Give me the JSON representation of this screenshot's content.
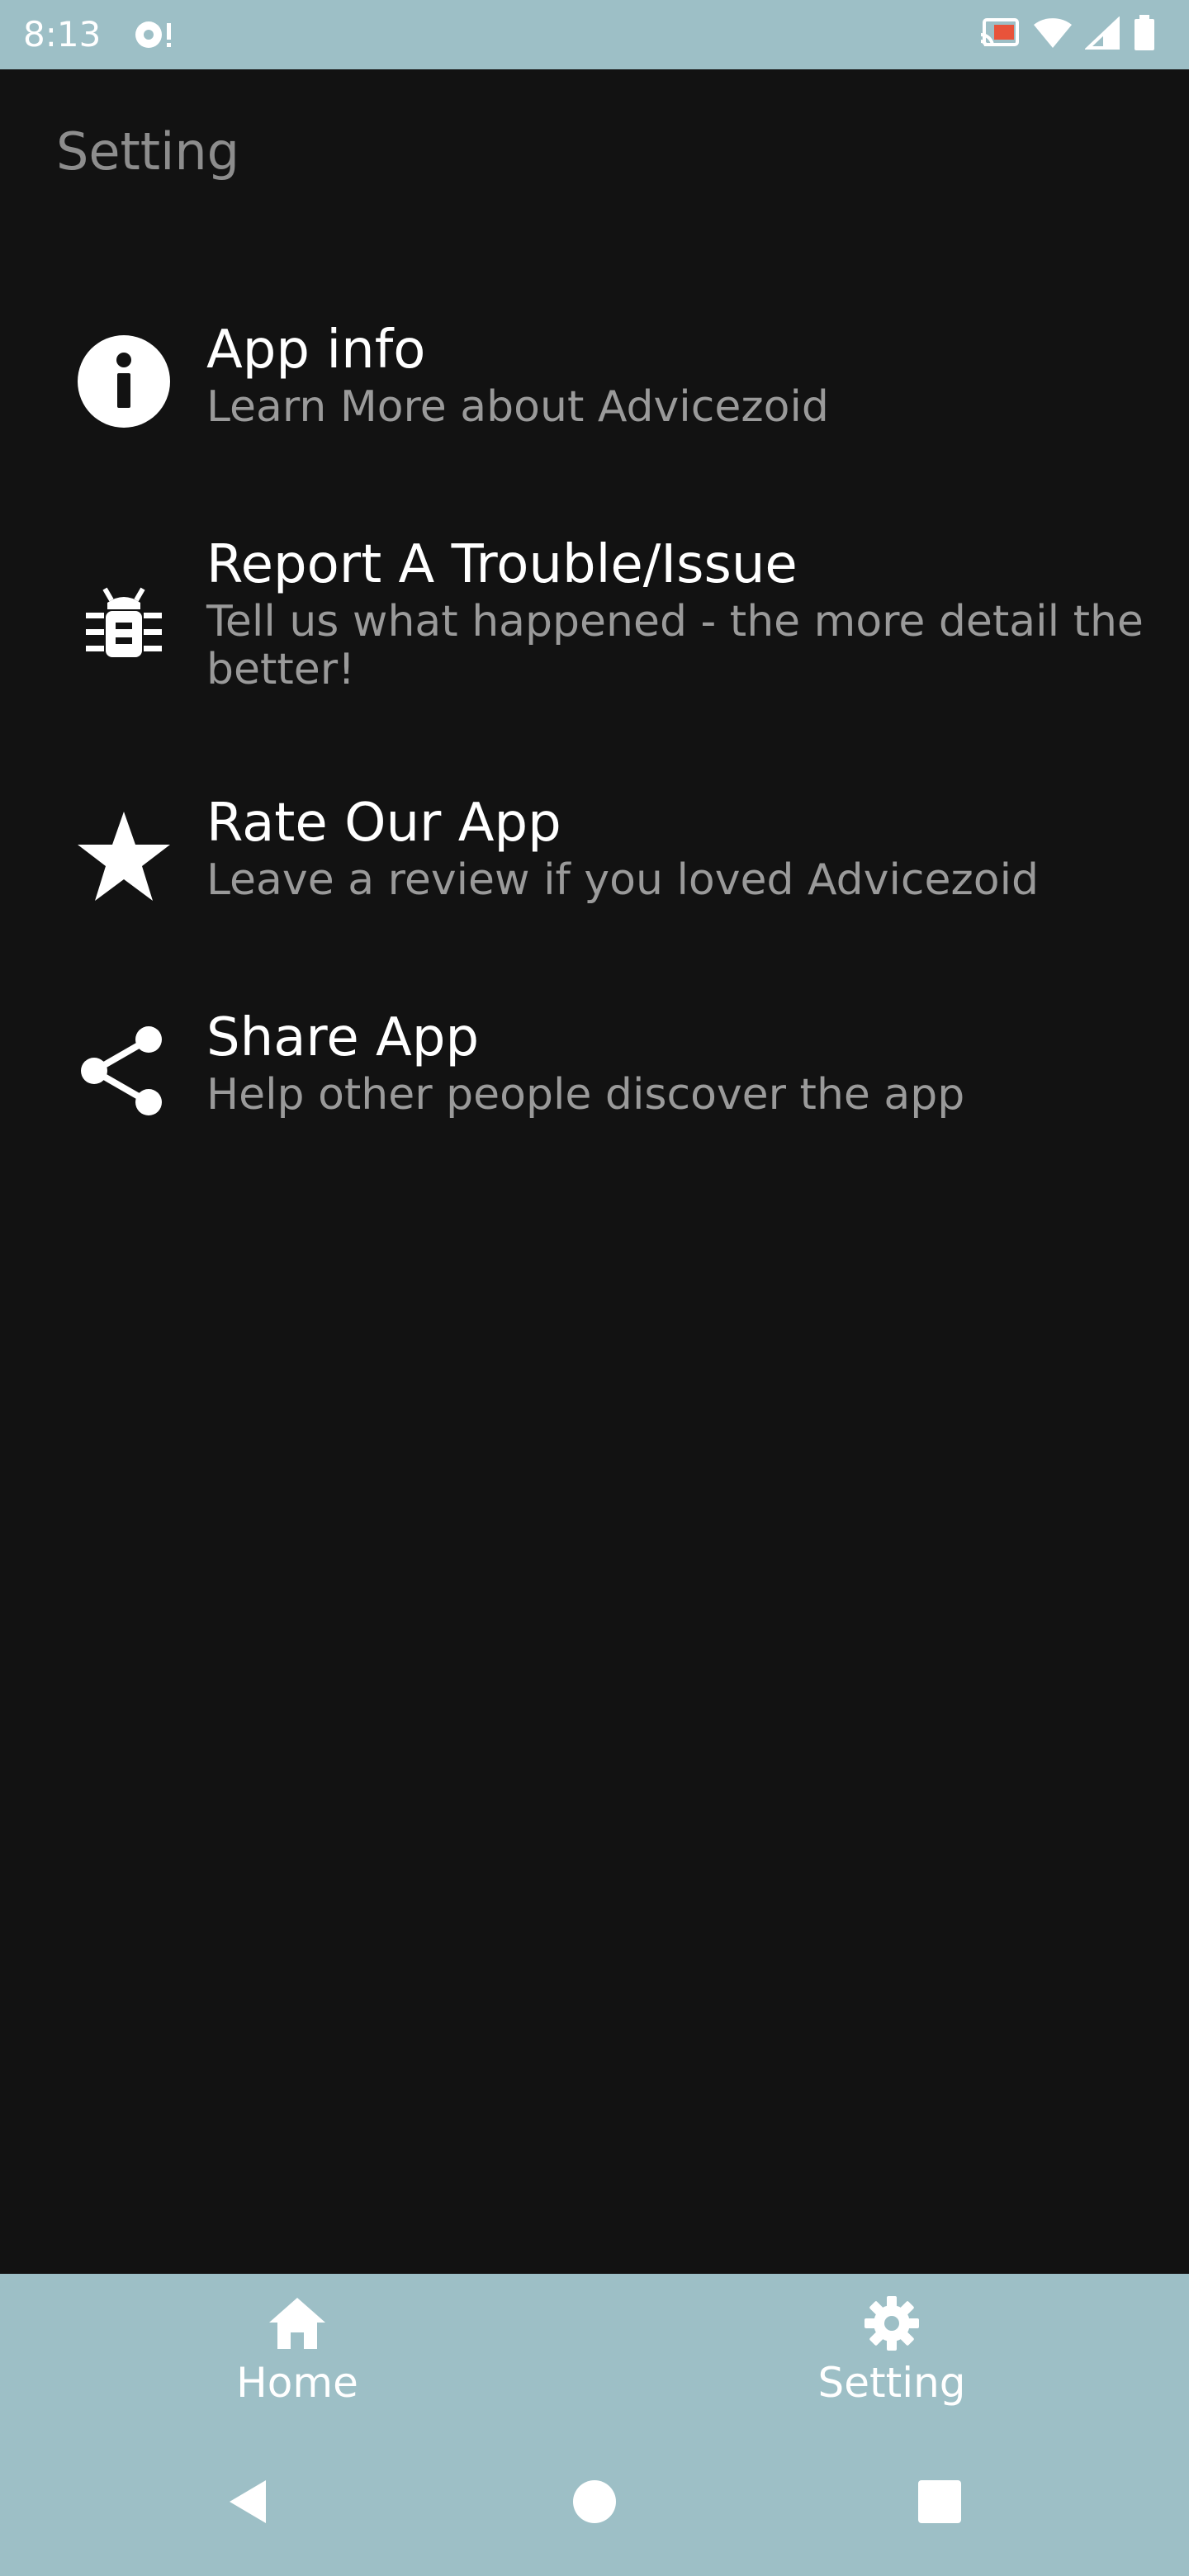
{
  "status_bar": {
    "time": "8:13"
  },
  "page": {
    "title": "Setting"
  },
  "menu": {
    "items": [
      {
        "icon": "info-icon",
        "title": "App info",
        "subtitle": "Learn More about Advicezoid"
      },
      {
        "icon": "bug-icon",
        "title": "Report A Trouble/Issue",
        "subtitle": "Tell us what happened - the more detail the better!"
      },
      {
        "icon": "star-icon",
        "title": "Rate Our App",
        "subtitle": "Leave a review if you loved Advicezoid"
      },
      {
        "icon": "share-icon",
        "title": "Share App",
        "subtitle": "Help other people discover the app"
      }
    ]
  },
  "bottom_nav": {
    "items": [
      {
        "icon": "home-icon",
        "label": "Home"
      },
      {
        "icon": "gear-icon",
        "label": "Setting"
      }
    ]
  },
  "colors": {
    "background": "#121212",
    "bars": "#9dbfc6",
    "title_text": "#ffffff",
    "subtitle_text": "#9a9a9a",
    "page_title_text": "#8d8d8d"
  }
}
